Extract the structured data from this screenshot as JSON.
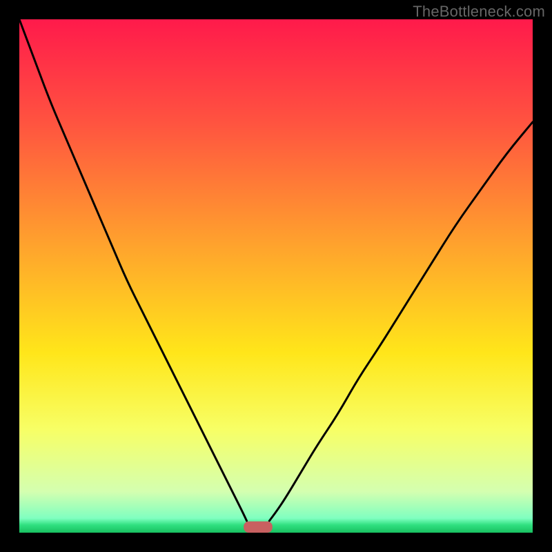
{
  "watermark": "TheBottleneck.com",
  "chart_data": {
    "type": "line",
    "title": "",
    "xlabel": "",
    "ylabel": "",
    "xlim": [
      0,
      100
    ],
    "ylim": [
      0,
      100
    ],
    "background": {
      "type": "vertical-gradient",
      "stops": [
        {
          "offset": 0.0,
          "color": "#ff1a4b"
        },
        {
          "offset": 0.2,
          "color": "#ff5340"
        },
        {
          "offset": 0.45,
          "color": "#ffa62c"
        },
        {
          "offset": 0.65,
          "color": "#ffe61a"
        },
        {
          "offset": 0.8,
          "color": "#f7ff66"
        },
        {
          "offset": 0.92,
          "color": "#d4ffb0"
        },
        {
          "offset": 0.972,
          "color": "#7fffc0"
        },
        {
          "offset": 0.985,
          "color": "#30e080"
        },
        {
          "offset": 1.0,
          "color": "#18c060"
        }
      ]
    },
    "curves": {
      "left": {
        "description": "left falling branch from top-left toward minimum",
        "x": [
          0,
          3,
          6,
          9,
          12,
          15,
          18,
          21,
          24,
          27,
          30,
          33,
          36,
          38,
          40,
          42,
          43.5,
          44.3
        ],
        "y": [
          100,
          92,
          84,
          77,
          70,
          63,
          56,
          49,
          43,
          37,
          31,
          25,
          19,
          15,
          11,
          7,
          4,
          2.3
        ]
      },
      "right": {
        "description": "right rising branch from minimum toward upper-right",
        "x": [
          48.7,
          50,
          52,
          55,
          58,
          62,
          66,
          70,
          75,
          80,
          85,
          90,
          95,
          100
        ],
        "y": [
          2.3,
          4,
          7,
          12,
          17,
          23,
          30,
          36,
          44,
          52,
          60,
          67,
          74,
          80
        ]
      }
    },
    "marker": {
      "description": "salmon rounded bar at minimum on x-axis",
      "x_center": 46.5,
      "y": 1.1,
      "width": 5.6,
      "height": 2.2,
      "color": "#c86060"
    }
  }
}
